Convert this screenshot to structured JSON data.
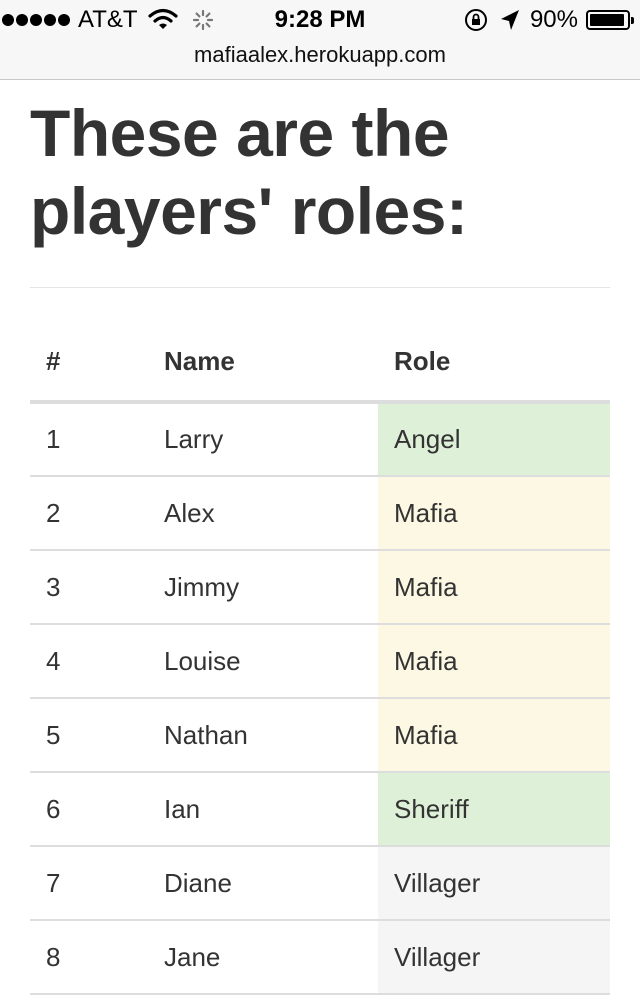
{
  "status_bar": {
    "carrier": "AT&T",
    "time": "9:28 PM",
    "battery_percent": "90%",
    "battery_level": 0.9,
    "signal_bars": 5
  },
  "browser": {
    "url": "mafiaalex.herokuapp.com"
  },
  "page": {
    "title": "These are the players' roles:"
  },
  "table": {
    "headers": [
      "#",
      "Name",
      "Role"
    ],
    "rows": [
      {
        "num": "1",
        "name": "Larry",
        "role": "Angel",
        "status": "success"
      },
      {
        "num": "2",
        "name": "Alex",
        "role": "Mafia",
        "status": "warning"
      },
      {
        "num": "3",
        "name": "Jimmy",
        "role": "Mafia",
        "status": "warning"
      },
      {
        "num": "4",
        "name": "Louise",
        "role": "Mafia",
        "status": "warning"
      },
      {
        "num": "5",
        "name": "Nathan",
        "role": "Mafia",
        "status": "warning"
      },
      {
        "num": "6",
        "name": "Ian",
        "role": "Sheriff",
        "status": "success"
      },
      {
        "num": "7",
        "name": "Diane",
        "role": "Villager",
        "status": "neutral"
      },
      {
        "num": "8",
        "name": "Jane",
        "role": "Villager",
        "status": "neutral"
      }
    ]
  },
  "colors": {
    "success": "#dff0d8",
    "warning": "#fcf8e3",
    "neutral": "#f5f5f5",
    "text": "#333333"
  },
  "icons": {
    "signal": "signal-dots-icon",
    "wifi": "wifi-icon",
    "activity": "activity-spinner-icon",
    "rotation_lock": "rotation-lock-icon",
    "location": "location-arrow-icon",
    "battery": "battery-icon"
  }
}
